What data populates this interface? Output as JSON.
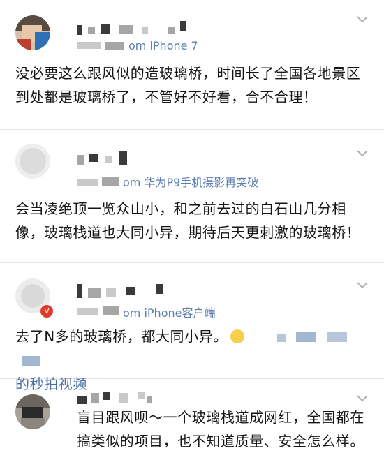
{
  "posts": [
    {
      "source": "om iPhone 7",
      "text": "没必要这么跟风似的造玻璃桥，时间长了全国各地景区到处都是玻璃桥了，不管好不好看，合不合理！"
    },
    {
      "source": "om 华为P9手机摄影再突破",
      "text": "会当凌绝顶一览众山小，和之前去过的白石山几分相像，玻璃栈道也大同小异，期待后天更刺激的玻璃桥！"
    },
    {
      "source": "om iPhone客户端",
      "text": "去了N多的玻璃桥，都大同小异。",
      "link_text": "的秒拍视频"
    },
    {
      "text": "盲目跟风呗～一个玻璃栈道成网红，全国都在搞类似的项目，也不知道质量、安全怎么样。"
    }
  ],
  "icons": {
    "chevron": "chevron-down-icon",
    "emoji": "emoji-face-icon",
    "badge": "verified-badge-icon"
  },
  "colors": {
    "link": "#4a6fa5",
    "meta": "#7a7a7a",
    "divider": "#e6e6e6"
  }
}
